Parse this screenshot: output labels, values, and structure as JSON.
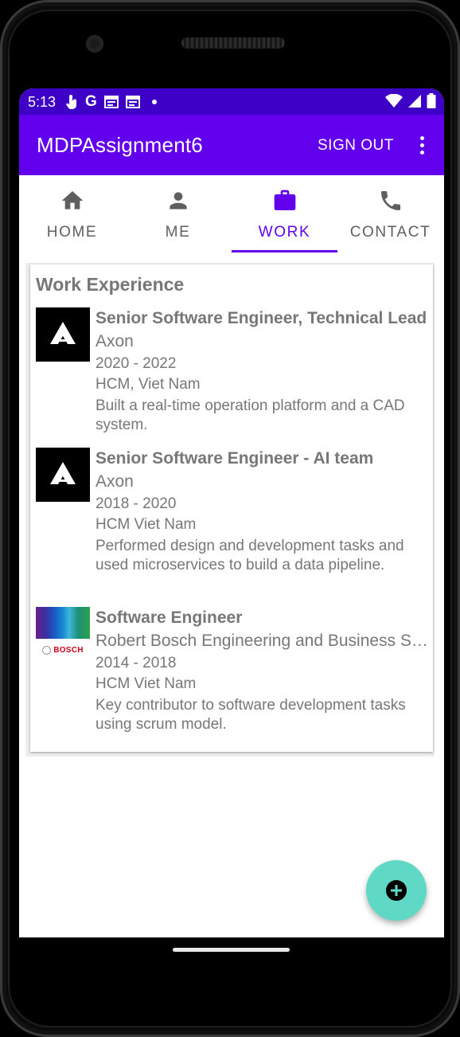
{
  "status_bar": {
    "time": "5:13"
  },
  "app_bar": {
    "title": "MDPAssignment6",
    "sign_out": "SIGN OUT"
  },
  "tabs": [
    {
      "label": "HOME",
      "icon": "home-icon"
    },
    {
      "label": "ME",
      "icon": "person-icon"
    },
    {
      "label": "WORK",
      "icon": "briefcase-icon",
      "active": true
    },
    {
      "label": "CONTACT",
      "icon": "phone-icon"
    }
  ],
  "work": {
    "heading": "Work Experience",
    "jobs": [
      {
        "title": "Senior Software Engineer, Technical Lead",
        "company": "Axon",
        "years": "2020 - 2022",
        "location": "HCM, Viet Nam",
        "description": "Built a real-time operation platform and a CAD system.",
        "logo": "axon-logo"
      },
      {
        "title": "Senior Software Engineer - AI team",
        "company": "Axon",
        "years": "2018 - 2020",
        "location": "HCM Viet Nam",
        "description": "Performed design and development tasks and used microservices to build a data pipeline.",
        "logo": "axon-logo"
      },
      {
        "title": "Software Engineer",
        "company": "Robert Bosch Engineering and Business Solutions",
        "years": "2014 - 2018",
        "location": "HCM Viet Nam",
        "description": "Key contributor to software development tasks using scrum model.",
        "logo": "bosch-logo",
        "logo_text": "BOSCH"
      }
    ]
  },
  "colors": {
    "primary": "#6200ee",
    "status_bar": "#3e00c6",
    "fab": "#5fd8c6",
    "text": "#777777"
  }
}
